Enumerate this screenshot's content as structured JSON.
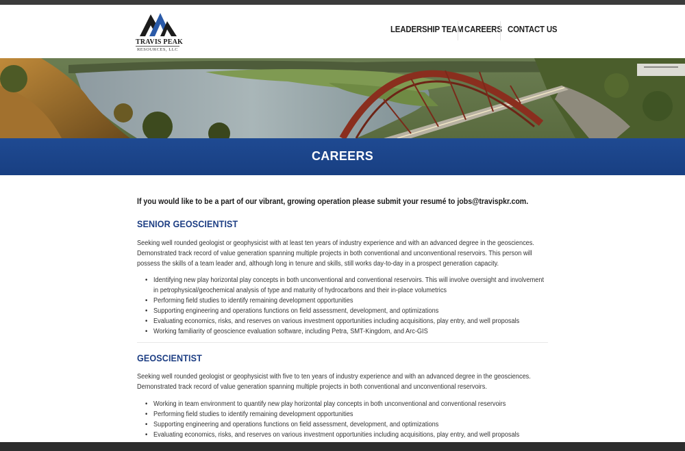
{
  "logo": {
    "name": "TRAVIS PEAK",
    "sub": "RESOURCES, LLC"
  },
  "nav": {
    "items": [
      {
        "label": "LEADERSHIP TEAM"
      },
      {
        "label": "CAREERS"
      },
      {
        "label": "CONTACT US"
      }
    ]
  },
  "page": {
    "title": "CAREERS",
    "intro": "If you would like to be a part of our vibrant, growing operation please submit your resumé to jobs@travispkr.com."
  },
  "jobs": [
    {
      "title": "SENIOR GEOSCIENTIST",
      "description": "Seeking well rounded geologist or geophysicist with at least ten years of industry experience and with an advanced degree in the geosciences. Demonstrated track record of value generation spanning multiple projects in both conventional and unconventional reservoirs. This person will possess the skills of a team leader and, although long in tenure and skills, still works day-to-day in a prospect generation capacity.",
      "bullets": [
        "Identifying new play horizontal play concepts in both unconventional and conventional reservoirs. This will involve oversight and involvement in petrophysical/geochemical analysis of type and maturity of hydrocarbons and their in-place volumetrics",
        "Performing field studies to identify remaining development opportunities",
        "Supporting engineering and operations functions on field assessment, development, and optimizations",
        "Evaluating economics, risks, and reserves on various investment opportunities including acquisitions, play entry, and well proposals",
        "Working familiarity of geoscience evaluation software, including Petra, SMT-Kingdom, and Arc-GIS"
      ]
    },
    {
      "title": "GEOSCIENTIST",
      "description": "Seeking well rounded geologist or geophysicist with five to ten years of industry experience and with an advanced degree in the geosciences. Demonstrated track record of value generation spanning multiple projects in both conventional and unconventional reservoirs.",
      "bullets": [
        "Working in team environment to quantify new play horizontal play concepts in both unconventional and conventional reservoirs",
        "Performing field studies to identify remaining development opportunities",
        "Supporting engineering and operations functions on field assessment, development, and optimizations",
        "Evaluating economics, risks, and reserves on various investment opportunities including acquisitions, play entry, and well proposals"
      ]
    }
  ],
  "colors": {
    "accent_blue": "#1e3f84",
    "banner_blue": "#1f4a92",
    "bridge": "#8a2e1e"
  }
}
